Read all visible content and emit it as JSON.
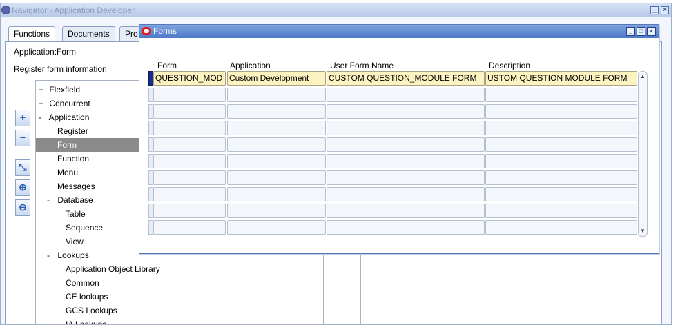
{
  "navigator": {
    "title": "Navigator - Application Developer",
    "tabs": [
      {
        "label": "Functions"
      },
      {
        "label": "Documents"
      },
      {
        "label": "Pro"
      }
    ],
    "application_label": "Application:Form",
    "info_text": "Register form information",
    "tree": [
      {
        "expander": "+",
        "label": "Flexfield"
      },
      {
        "expander": "+",
        "label": "Concurrent"
      },
      {
        "expander": "-",
        "label": "Application"
      },
      {
        "expander": "",
        "label": "Register"
      },
      {
        "expander": "",
        "label": "Form"
      },
      {
        "expander": "",
        "label": "Function"
      },
      {
        "expander": "",
        "label": "Menu"
      },
      {
        "expander": "",
        "label": "Messages"
      },
      {
        "expander": "-",
        "label": "Database"
      },
      {
        "expander": "",
        "label": "Table"
      },
      {
        "expander": "",
        "label": "Sequence"
      },
      {
        "expander": "",
        "label": "View"
      },
      {
        "expander": "-",
        "label": "Lookups"
      },
      {
        "expander": "",
        "label": "Application Object Library"
      },
      {
        "expander": "",
        "label": "Common"
      },
      {
        "expander": "",
        "label": "CE lookups"
      },
      {
        "expander": "",
        "label": "GCS Lookups"
      },
      {
        "expander": "",
        "label": "IA Lookups"
      }
    ],
    "selected_item": "Form",
    "side_buttons": [
      "expand-icon",
      "collapse-icon",
      "expand-branch-icon",
      "expand-all-icon",
      "collapse-all-icon"
    ]
  },
  "forms": {
    "title": "Forms",
    "columns": {
      "form": "Form",
      "application": "Application",
      "user_form_name": "User Form Name",
      "description": "Description"
    },
    "rows": [
      {
        "form": "QUESTION_MOD",
        "application": "Custom Development",
        "user_form_name": "CUSTOM QUESTION_MODULE FORM",
        "description": "USTOM QUESTION MODULE FORM"
      },
      {
        "form": "",
        "application": "",
        "user_form_name": "",
        "description": ""
      },
      {
        "form": "",
        "application": "",
        "user_form_name": "",
        "description": ""
      },
      {
        "form": "",
        "application": "",
        "user_form_name": "",
        "description": ""
      },
      {
        "form": "",
        "application": "",
        "user_form_name": "",
        "description": ""
      },
      {
        "form": "",
        "application": "",
        "user_form_name": "",
        "description": ""
      },
      {
        "form": "",
        "application": "",
        "user_form_name": "",
        "description": ""
      },
      {
        "form": "",
        "application": "",
        "user_form_name": "",
        "description": ""
      },
      {
        "form": "",
        "application": "",
        "user_form_name": "",
        "description": ""
      },
      {
        "form": "",
        "application": "",
        "user_form_name": "",
        "description": ""
      }
    ]
  },
  "colors": {
    "title_active": "#4e78c8",
    "highlight_cell": "#fcf3c0",
    "selected_tree_row": "#8a8a8a",
    "current_row_indicator": "#1a2a8a"
  }
}
